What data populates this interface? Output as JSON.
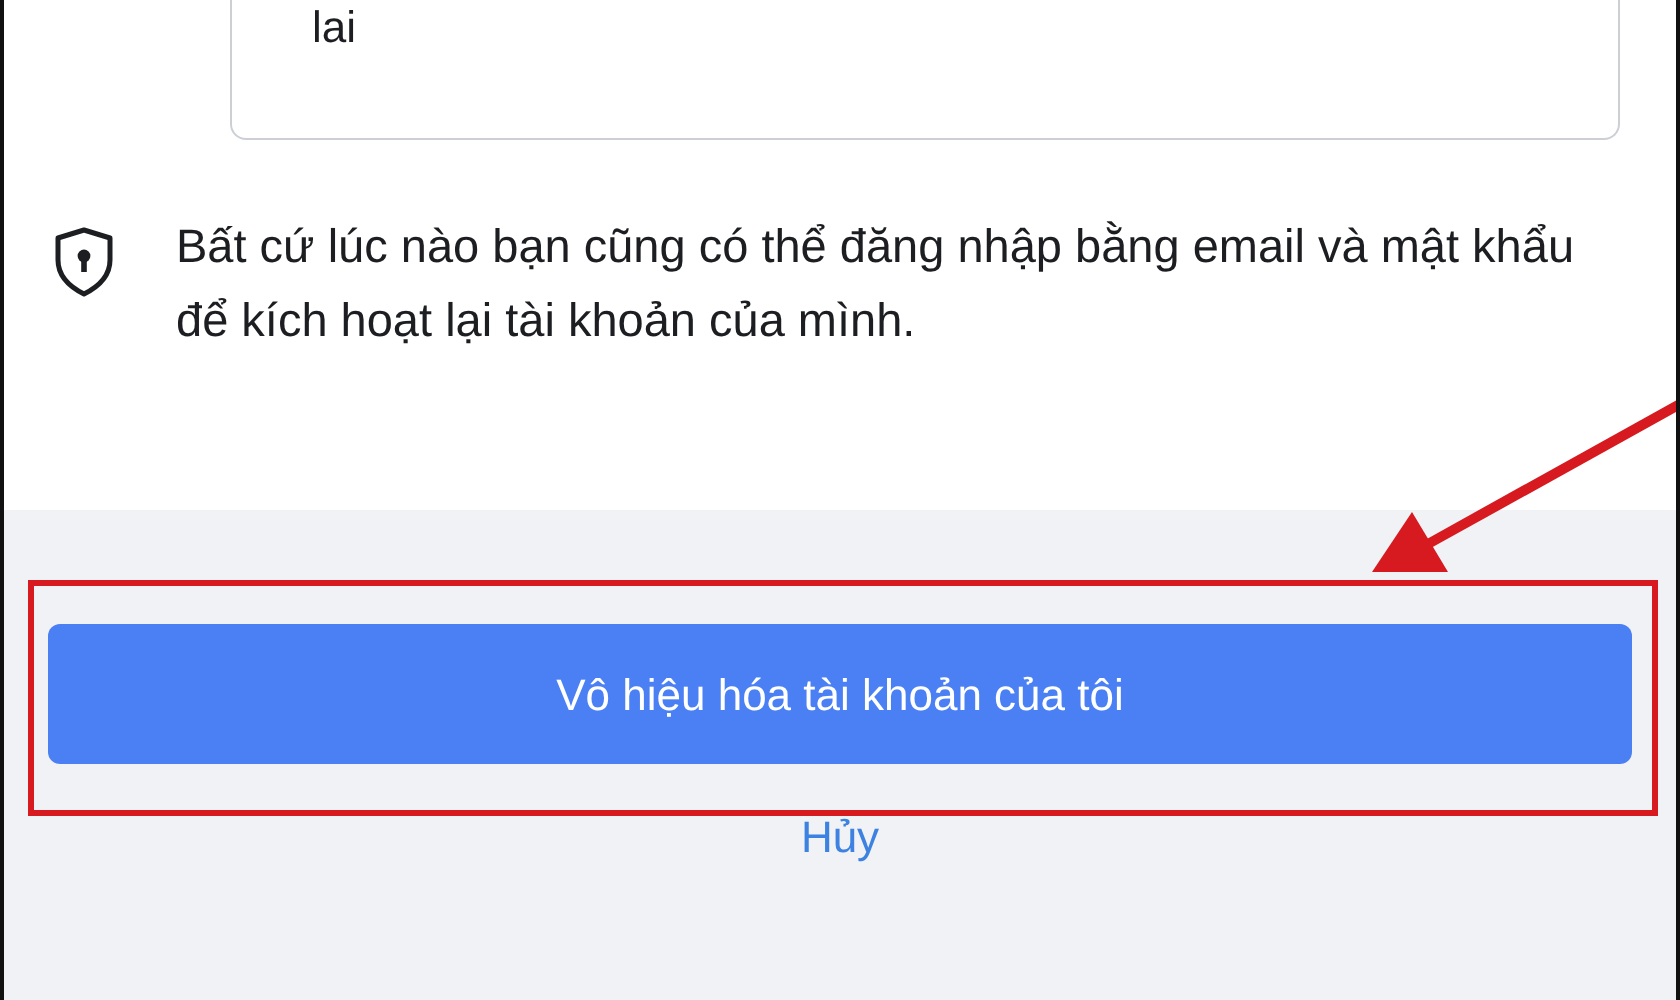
{
  "previous_option": {
    "text_tail": "lai"
  },
  "notice": {
    "text": "Bất cứ lúc nào bạn cũng có thể đăng nhập bằng email và mật khẩu để kích hoạt lại tài khoản của mình."
  },
  "buttons": [
    {
      "kind": "primary",
      "label": "Vô hiệu hóa tài khoản của tôi"
    },
    {
      "kind": "link",
      "label": "Hủy"
    }
  ]
}
